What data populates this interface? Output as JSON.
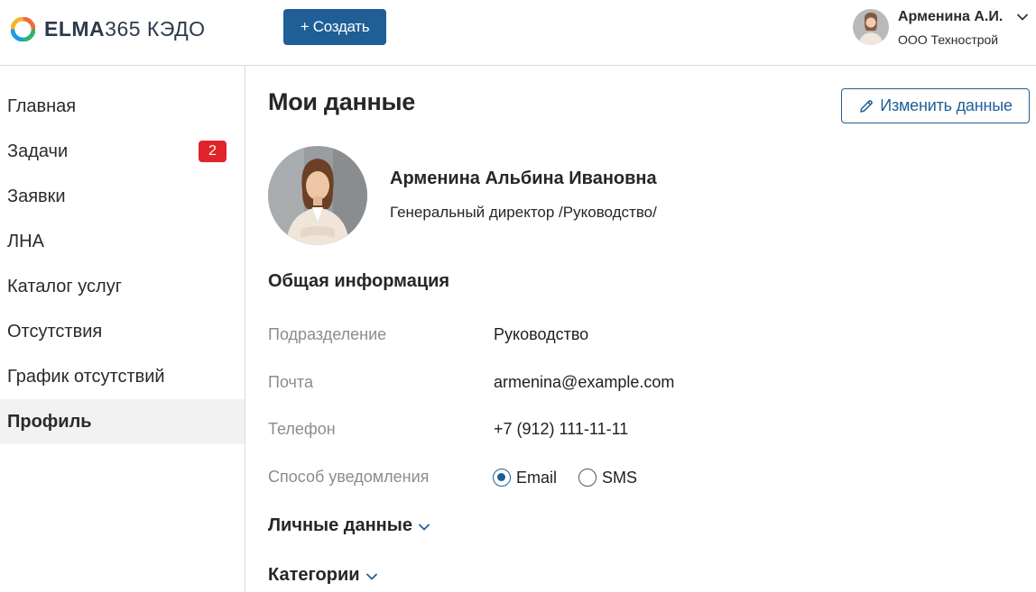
{
  "header": {
    "logo_bold": "ELMA",
    "logo_num": "365",
    "logo_rest": " КЭДО",
    "create_label": "+ Создать",
    "user_name": "Арменина А.И.",
    "user_org": "ООО Технострой"
  },
  "sidebar": {
    "items": [
      {
        "label": "Главная"
      },
      {
        "label": "Задачи",
        "badge": "2"
      },
      {
        "label": "Заявки"
      },
      {
        "label": "ЛНА"
      },
      {
        "label": "Каталог услуг"
      },
      {
        "label": "Отсутствия"
      },
      {
        "label": "График отсутствий"
      },
      {
        "label": "Профиль",
        "active": true
      }
    ]
  },
  "main": {
    "title": "Мои данные",
    "edit_label": "Изменить данные",
    "full_name": "Арменина Альбина Ивановна",
    "position": "Генеральный директор /Руководство/",
    "general_title": "Общая информация",
    "fields": [
      {
        "label": "Подразделение",
        "value": "Руководство"
      },
      {
        "label": "Почта",
        "value": "armenina@example.com"
      },
      {
        "label": "Телефон",
        "value": "+7 (912) 111-11-11"
      }
    ],
    "notify_label": "Способ уведомления",
    "notify_options": [
      {
        "label": "Email",
        "checked": true
      },
      {
        "label": "SMS",
        "checked": false
      }
    ],
    "personal_title": "Личные данные",
    "categories_title": "Категории"
  },
  "colors": {
    "accent": "#1f5f96",
    "badge": "#e0242b",
    "active_bg": "#f2f2f2",
    "label_gray": "#8c8c8c"
  },
  "icons": [
    "elma-logo-icon",
    "user-avatar",
    "chevron-down-icon",
    "pencil-icon",
    "profile-photo"
  ]
}
